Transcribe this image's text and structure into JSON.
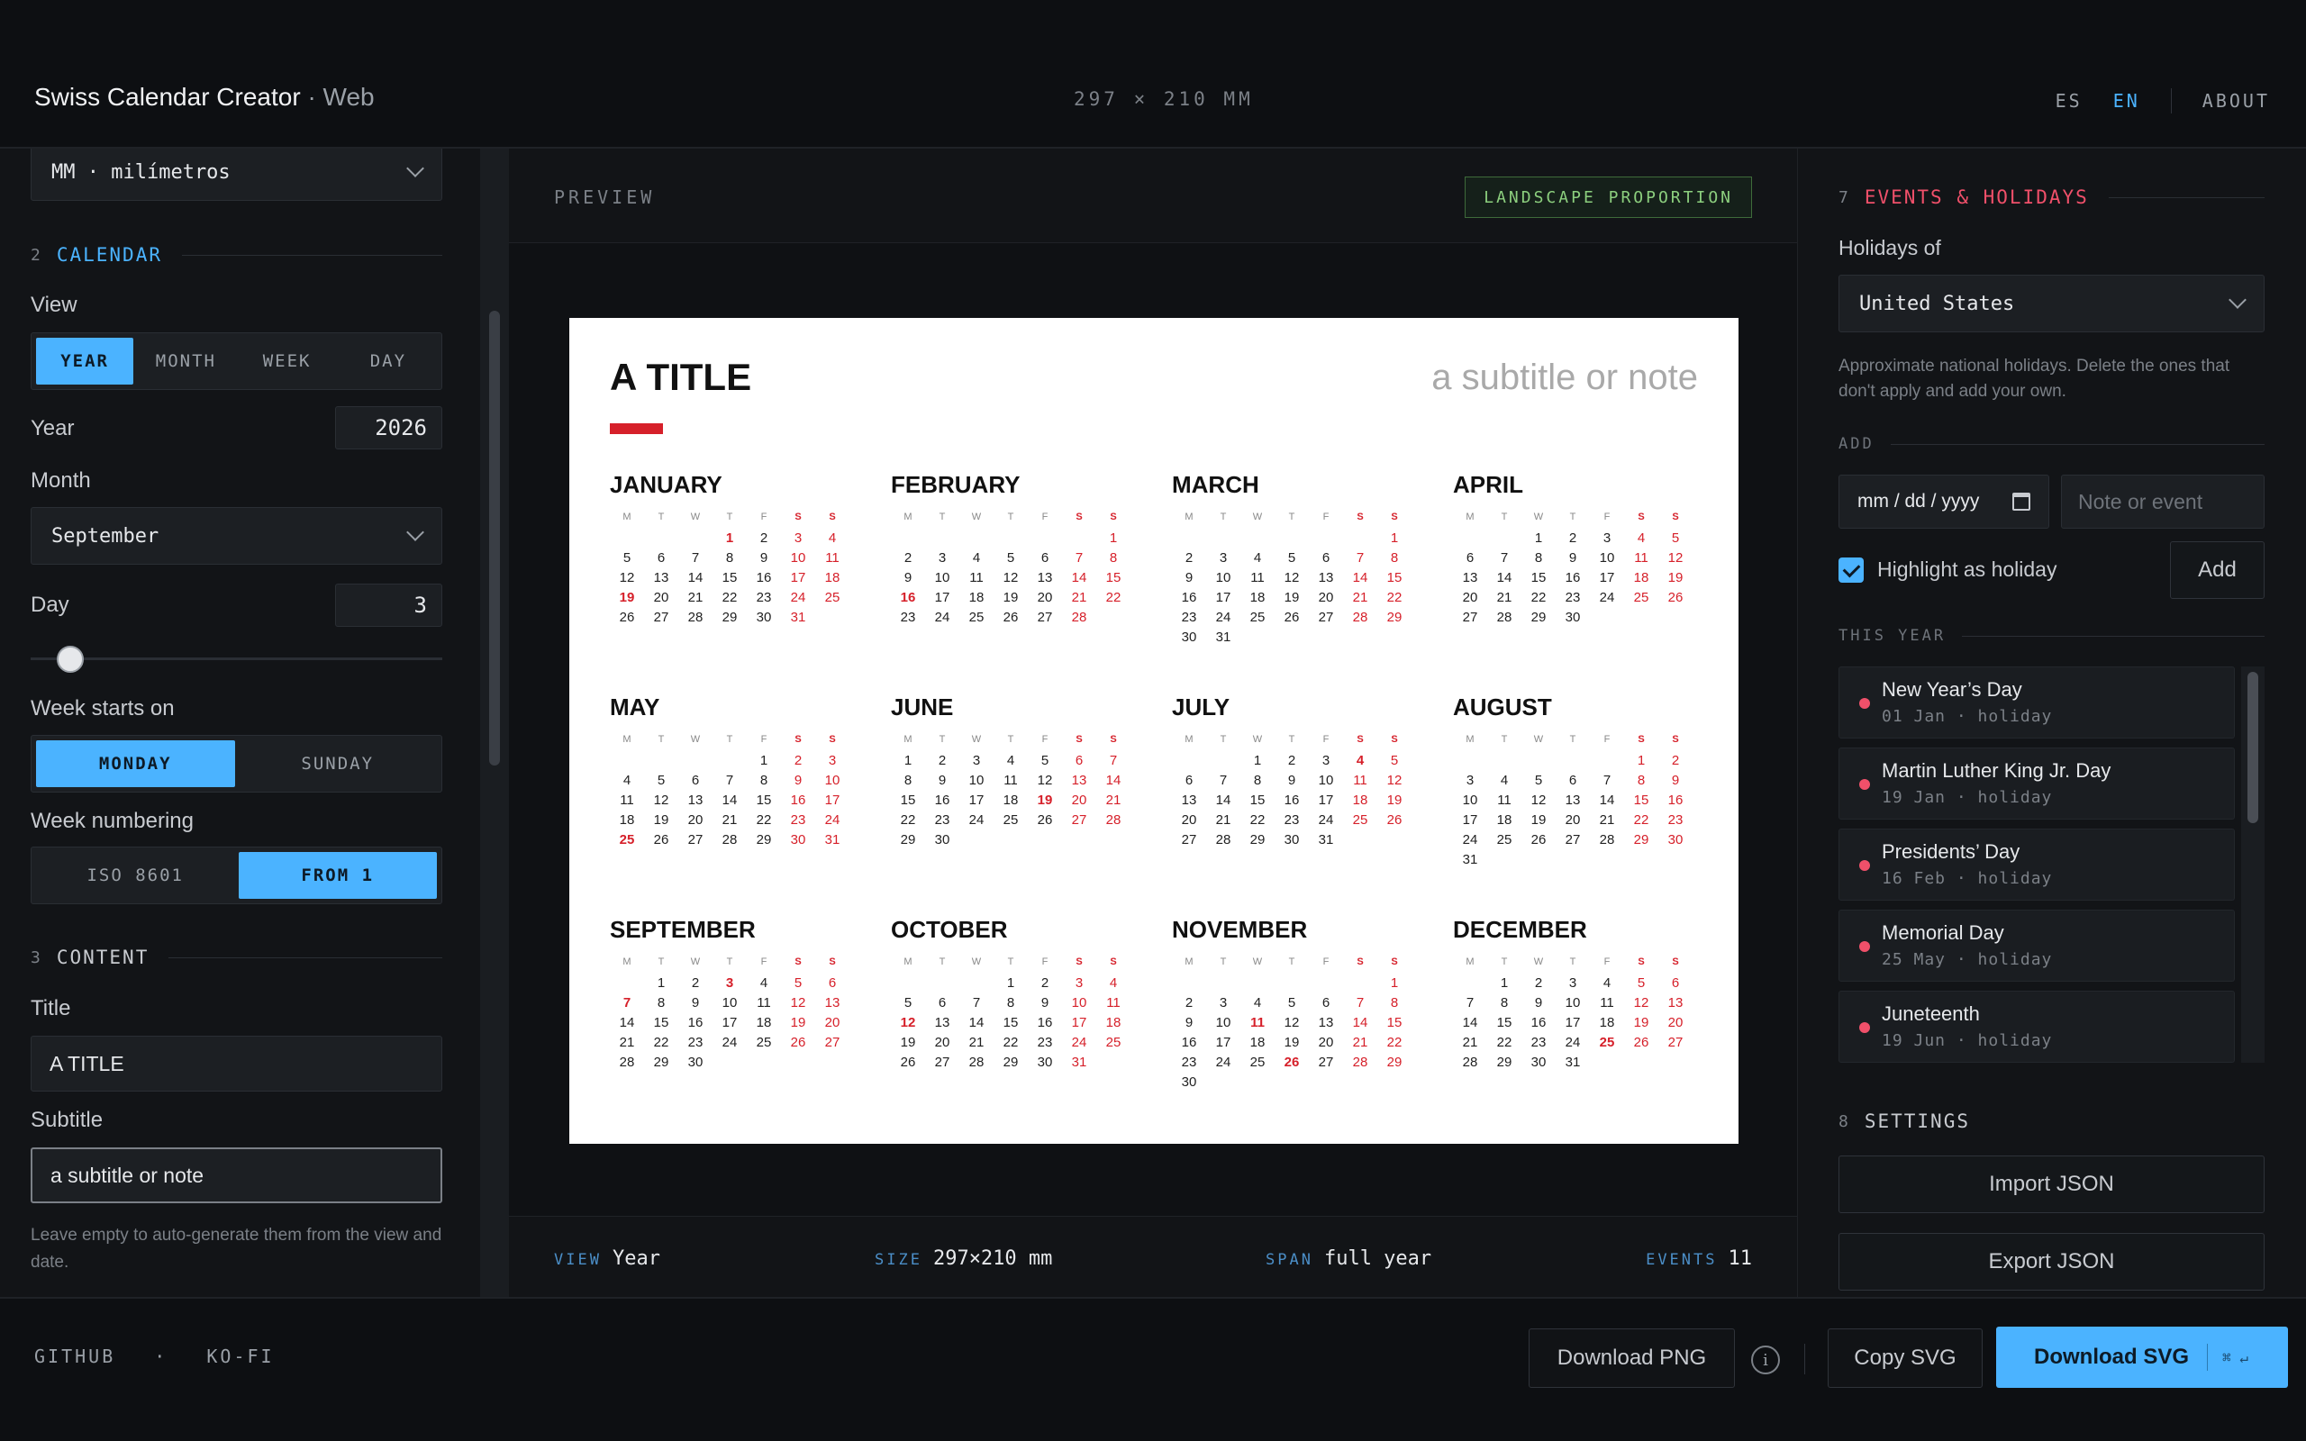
{
  "header": {
    "app_name": "Swiss Calendar Creator",
    "app_suffix": " · Web",
    "dimensions": "297 × 210 MM",
    "lang_es": "ES",
    "lang_en": "EN",
    "about": "ABOUT"
  },
  "left": {
    "unit_select": "MM · milímetros",
    "calendar_section": {
      "num": "2",
      "title": "CALENDAR"
    },
    "view_label": "View",
    "view_options": [
      "YEAR",
      "MONTH",
      "WEEK",
      "DAY"
    ],
    "view_selected": "YEAR",
    "year_label": "Year",
    "year_value": "2026",
    "month_label": "Month",
    "month_value": "September",
    "day_label": "Day",
    "day_value": "3",
    "day_slider_fraction": 0.06,
    "week_start_label": "Week starts on",
    "week_start_options": [
      "MONDAY",
      "SUNDAY"
    ],
    "week_num_label": "Week numbering",
    "week_num_options": [
      "ISO 8601",
      "FROM 1"
    ],
    "content_section": {
      "num": "3",
      "title": "CONTENT"
    },
    "title_label": "Title",
    "title_value": "A TITLE",
    "subtitle_label": "Subtitle",
    "subtitle_value": "a subtitle or note",
    "hint": "Leave empty to auto-generate them from the view and date."
  },
  "center": {
    "preview_label": "PREVIEW",
    "badge": "LANDSCAPE PROPORTION",
    "calendar": {
      "title": "A TITLE",
      "subtitle": "a subtitle or note",
      "weekday_headers": [
        "M",
        "T",
        "W",
        "T",
        "F",
        "S",
        "S"
      ],
      "accent_color": "#d6202a",
      "months": [
        {
          "name": "JANUARY",
          "offset": 3,
          "days": 31,
          "holidays": [
            1,
            19
          ]
        },
        {
          "name": "FEBRUARY",
          "offset": 6,
          "days": 28,
          "holidays": [
            16
          ]
        },
        {
          "name": "MARCH",
          "offset": 6,
          "days": 31,
          "holidays": []
        },
        {
          "name": "APRIL",
          "offset": 2,
          "days": 30,
          "holidays": []
        },
        {
          "name": "MAY",
          "offset": 4,
          "days": 31,
          "holidays": [
            25
          ]
        },
        {
          "name": "JUNE",
          "offset": 0,
          "days": 30,
          "holidays": [
            19
          ]
        },
        {
          "name": "JULY",
          "offset": 2,
          "days": 31,
          "holidays": [
            4
          ]
        },
        {
          "name": "AUGUST",
          "offset": 5,
          "days": 31,
          "holidays": []
        },
        {
          "name": "SEPTEMBER",
          "offset": 1,
          "days": 30,
          "holidays": [
            3,
            7
          ]
        },
        {
          "name": "OCTOBER",
          "offset": 3,
          "days": 31,
          "holidays": [
            12
          ]
        },
        {
          "name": "NOVEMBER",
          "offset": 6,
          "days": 30,
          "holidays": [
            11,
            26
          ]
        },
        {
          "name": "DECEMBER",
          "offset": 1,
          "days": 31,
          "holidays": [
            25
          ]
        }
      ]
    },
    "status": {
      "view_key": "VIEW",
      "view_val": "Year",
      "size_key": "SIZE",
      "size_val": "297×210 mm",
      "span_key": "SPAN",
      "span_val": "full year",
      "events_key": "EVENTS",
      "events_val": "11"
    }
  },
  "right": {
    "events_section": {
      "num": "7",
      "title": "EVENTS & HOLIDAYS"
    },
    "holidays_of_label": "Holidays of",
    "country": "United States",
    "hint": "Approximate national holidays. Delete the ones that don't apply and add your own.",
    "add_label": "ADD",
    "date_placeholder": "mm / dd / yyyy",
    "note_placeholder": "Note or event",
    "highlight_label": "Highlight as holiday",
    "add_button": "Add",
    "this_year_label": "THIS YEAR",
    "events": [
      {
        "name": "New Year’s Day",
        "date": "01 Jan · holiday"
      },
      {
        "name": "Martin Luther King Jr. Day",
        "date": "19 Jan · holiday"
      },
      {
        "name": "Presidents’ Day",
        "date": "16 Feb · holiday"
      },
      {
        "name": "Memorial Day",
        "date": "25 May · holiday"
      },
      {
        "name": "Juneteenth",
        "date": "19 Jun · holiday"
      }
    ],
    "settings_section": {
      "num": "8",
      "title": "SETTINGS"
    },
    "import_json": "Import JSON",
    "export_json": "Export JSON"
  },
  "footer": {
    "github": "GITHUB",
    "sep": "·",
    "kofi": "KO-FI",
    "download_png": "Download PNG",
    "info": "i",
    "copy_svg": "Copy SVG",
    "download_svg": "Download SVG",
    "download_svg_kbd": "⌘ ↵"
  }
}
